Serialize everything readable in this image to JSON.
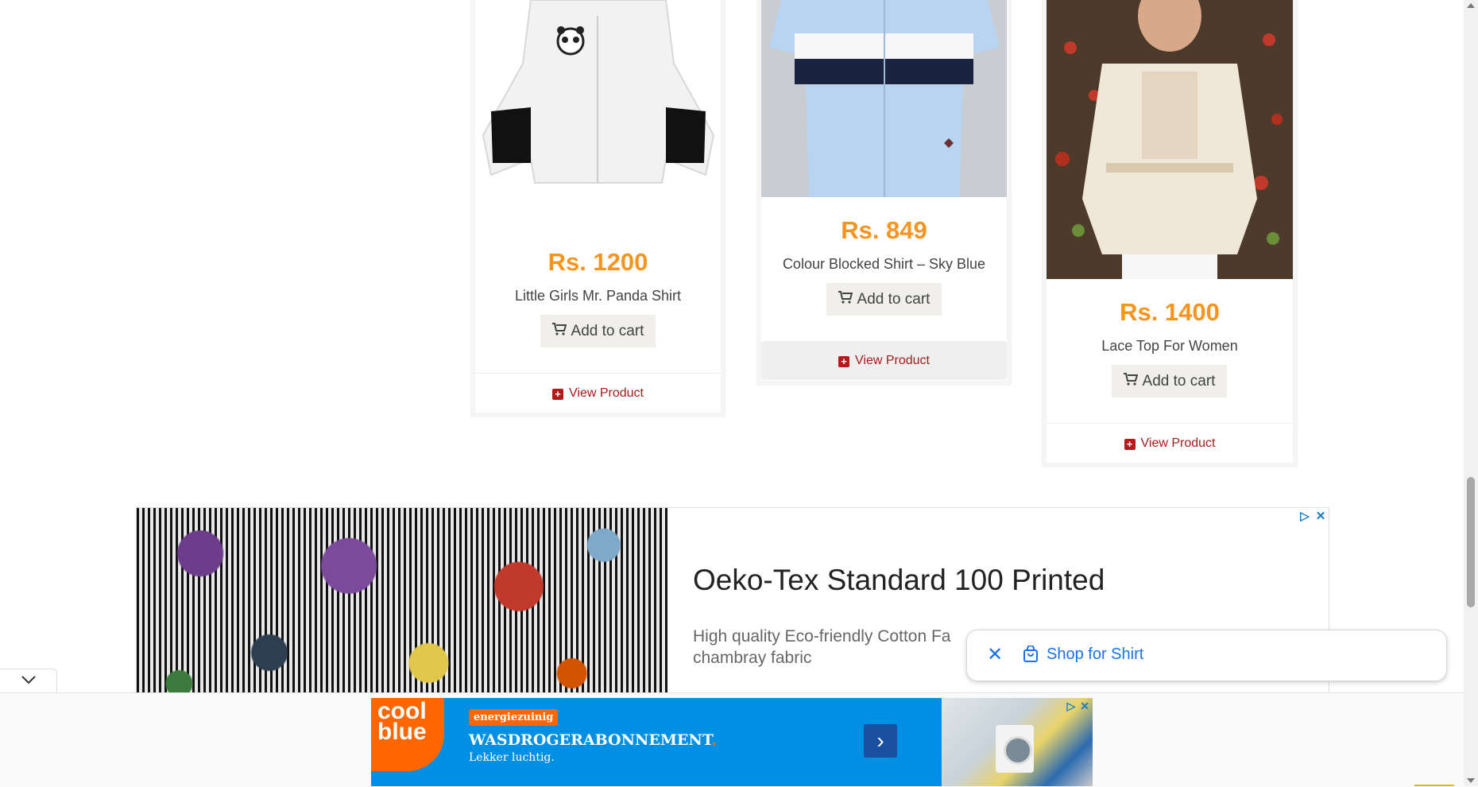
{
  "products": [
    {
      "price": "Rs. 1200",
      "name": "Little Girls Mr. Panda Shirt",
      "cart_label": "Add to cart",
      "view_label": "View Product"
    },
    {
      "price": "Rs. 849",
      "name": "Colour Blocked Shirt – Sky Blue",
      "cart_label": "Add to cart",
      "view_label": "View Product"
    },
    {
      "price": "Rs. 1400",
      "name": "Lace Top For Women",
      "cart_label": "Add to cart",
      "view_label": "View Product"
    }
  ],
  "ad": {
    "title": "Oeko-Tex Standard 100 Printed",
    "description": "High quality Eco-friendly Cotton Fa",
    "description_line2": "chambray fabric"
  },
  "shop_popup": {
    "label": "Shop for Shirt"
  },
  "bottom_ad": {
    "logo_line1": "cool",
    "logo_line2": "blue",
    "badge": "energiezuinig",
    "headline": "WASDROGERABONNEMENT",
    "headline_dot": ".",
    "subline": "Lekker luchtig."
  },
  "colors": {
    "price": "#f7941d",
    "view_link": "#a21c1c",
    "shop_blue": "#1a73e8",
    "coolblue": "#0090e3",
    "coolblue_orange": "#ff6600"
  }
}
